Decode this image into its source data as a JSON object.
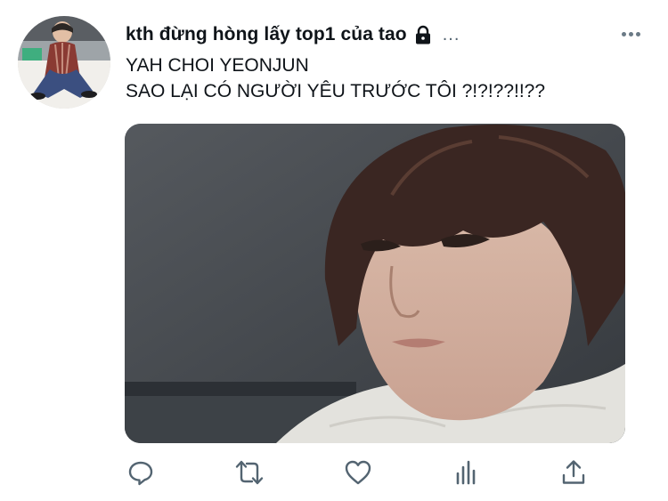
{
  "tweet": {
    "author": {
      "display_name": "kth đừng hòng lấy top1 của tao",
      "protected_icon": "lock-icon",
      "truncation": "...",
      "avatar": "profile-photo-person-sitting"
    },
    "more_icon": "more-options-icon",
    "text_lines": [
      "YAH CHOI YEONJUN",
      "SAO LẠI CÓ NGƯỜI YÊU TRƯỚC TÔI ?!?!??!!??"
    ],
    "media": {
      "description_icon": "photo-person-with-bangs"
    },
    "actions": [
      {
        "name": "reply",
        "icon": "reply-icon"
      },
      {
        "name": "retweet",
        "icon": "retweet-icon"
      },
      {
        "name": "like",
        "icon": "heart-icon"
      },
      {
        "name": "analytics",
        "icon": "analytics-icon"
      },
      {
        "name": "share",
        "icon": "share-icon"
      }
    ]
  },
  "colors": {
    "text": "#0f1419",
    "icon": "#536471",
    "background": "#ffffff"
  }
}
